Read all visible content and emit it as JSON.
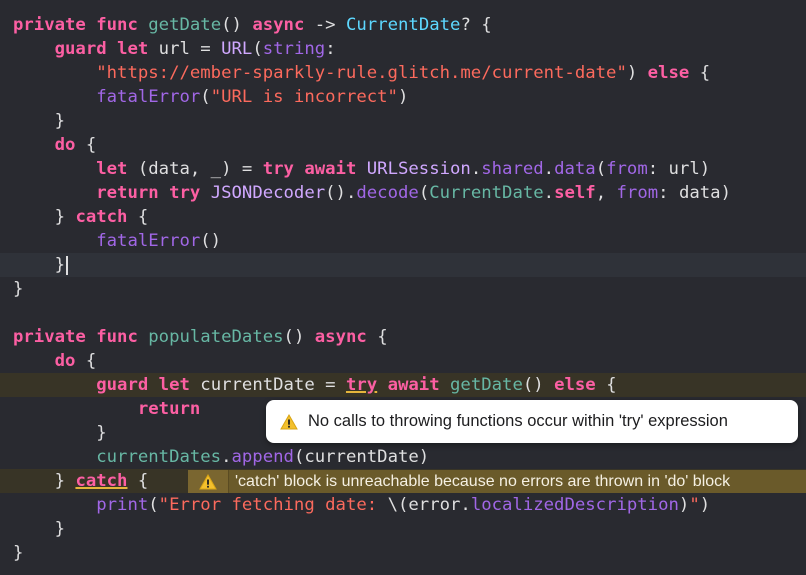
{
  "editor": {
    "lines": [
      {
        "segments": [
          {
            "t": "private",
            "c": "kw"
          },
          {
            "t": " ",
            "c": "plain"
          },
          {
            "t": "func",
            "c": "kw"
          },
          {
            "t": " ",
            "c": "plain"
          },
          {
            "t": "getDate",
            "c": "fn-decl"
          },
          {
            "t": "() ",
            "c": "plain"
          },
          {
            "t": "async",
            "c": "kw"
          },
          {
            "t": " -> ",
            "c": "plain"
          },
          {
            "t": "CurrentDate",
            "c": "type-decl"
          },
          {
            "t": "? {",
            "c": "plain"
          }
        ]
      },
      {
        "segments": [
          {
            "t": "    ",
            "c": "plain"
          },
          {
            "t": "guard",
            "c": "kw"
          },
          {
            "t": " ",
            "c": "plain"
          },
          {
            "t": "let",
            "c": "kw"
          },
          {
            "t": " url = ",
            "c": "plain"
          },
          {
            "t": "URL",
            "c": "other-type"
          },
          {
            "t": "(",
            "c": "plain"
          },
          {
            "t": "string",
            "c": "fn"
          },
          {
            "t": ":",
            "c": "plain"
          }
        ]
      },
      {
        "segments": [
          {
            "t": "        ",
            "c": "plain"
          },
          {
            "t": "\"https://ember-sparkly-rule.glitch.me/current-date\"",
            "c": "str"
          },
          {
            "t": ") ",
            "c": "plain"
          },
          {
            "t": "else",
            "c": "kw"
          },
          {
            "t": " {",
            "c": "plain"
          }
        ]
      },
      {
        "segments": [
          {
            "t": "        ",
            "c": "plain"
          },
          {
            "t": "fatalError",
            "c": "fn"
          },
          {
            "t": "(",
            "c": "plain"
          },
          {
            "t": "\"URL is incorrect\"",
            "c": "str"
          },
          {
            "t": ")",
            "c": "plain"
          }
        ]
      },
      {
        "segments": [
          {
            "t": "    }",
            "c": "plain"
          }
        ]
      },
      {
        "segments": [
          {
            "t": "    ",
            "c": "plain"
          },
          {
            "t": "do",
            "c": "kw"
          },
          {
            "t": " {",
            "c": "plain"
          }
        ]
      },
      {
        "segments": [
          {
            "t": "        ",
            "c": "plain"
          },
          {
            "t": "let",
            "c": "kw"
          },
          {
            "t": " (data, _) = ",
            "c": "plain"
          },
          {
            "t": "try",
            "c": "kw"
          },
          {
            "t": " ",
            "c": "plain"
          },
          {
            "t": "await",
            "c": "kw"
          },
          {
            "t": " ",
            "c": "plain"
          },
          {
            "t": "URLSession",
            "c": "other-type"
          },
          {
            "t": ".",
            "c": "plain"
          },
          {
            "t": "shared",
            "c": "fn"
          },
          {
            "t": ".",
            "c": "plain"
          },
          {
            "t": "data",
            "c": "fn"
          },
          {
            "t": "(",
            "c": "plain"
          },
          {
            "t": "from",
            "c": "fn"
          },
          {
            "t": ": url)",
            "c": "plain"
          }
        ]
      },
      {
        "segments": [
          {
            "t": "        ",
            "c": "plain"
          },
          {
            "t": "return",
            "c": "kw"
          },
          {
            "t": " ",
            "c": "plain"
          },
          {
            "t": "try",
            "c": "kw"
          },
          {
            "t": " ",
            "c": "plain"
          },
          {
            "t": "JSONDecoder",
            "c": "other-type"
          },
          {
            "t": "().",
            "c": "plain"
          },
          {
            "t": "decode",
            "c": "fn"
          },
          {
            "t": "(",
            "c": "plain"
          },
          {
            "t": "CurrentDate",
            "c": "proj-fn"
          },
          {
            "t": ".",
            "c": "plain"
          },
          {
            "t": "self",
            "c": "kw"
          },
          {
            "t": ", ",
            "c": "plain"
          },
          {
            "t": "from",
            "c": "fn"
          },
          {
            "t": ": data)",
            "c": "plain"
          }
        ]
      },
      {
        "segments": [
          {
            "t": "    } ",
            "c": "plain"
          },
          {
            "t": "catch",
            "c": "kw"
          },
          {
            "t": " {",
            "c": "plain"
          }
        ]
      },
      {
        "segments": [
          {
            "t": "        ",
            "c": "plain"
          },
          {
            "t": "fatalError",
            "c": "fn"
          },
          {
            "t": "()",
            "c": "plain"
          }
        ]
      },
      {
        "segments": [
          {
            "t": "    }",
            "c": "plain"
          }
        ],
        "caret": true,
        "highlight": "current"
      },
      {
        "segments": [
          {
            "t": "}",
            "c": "plain"
          }
        ]
      },
      {
        "segments": []
      },
      {
        "segments": [
          {
            "t": "private",
            "c": "kw"
          },
          {
            "t": " ",
            "c": "plain"
          },
          {
            "t": "func",
            "c": "kw"
          },
          {
            "t": " ",
            "c": "plain"
          },
          {
            "t": "populateDates",
            "c": "fn-decl"
          },
          {
            "t": "() ",
            "c": "plain"
          },
          {
            "t": "async",
            "c": "kw"
          },
          {
            "t": " {",
            "c": "plain"
          }
        ]
      },
      {
        "segments": [
          {
            "t": "    ",
            "c": "plain"
          },
          {
            "t": "do",
            "c": "kw"
          },
          {
            "t": " {",
            "c": "plain"
          }
        ]
      },
      {
        "segments": [
          {
            "t": "        ",
            "c": "plain"
          },
          {
            "t": "guard",
            "c": "kw"
          },
          {
            "t": " ",
            "c": "plain"
          },
          {
            "t": "let",
            "c": "kw"
          },
          {
            "t": " currentDate = ",
            "c": "plain"
          },
          {
            "t": "try",
            "c": "kw",
            "warn": true
          },
          {
            "t": " ",
            "c": "plain"
          },
          {
            "t": "await",
            "c": "kw"
          },
          {
            "t": " ",
            "c": "plain"
          },
          {
            "t": "getDate",
            "c": "proj-fn"
          },
          {
            "t": "() ",
            "c": "plain"
          },
          {
            "t": "else",
            "c": "kw"
          },
          {
            "t": " {",
            "c": "plain"
          }
        ],
        "highlight": "warn"
      },
      {
        "segments": [
          {
            "t": "            ",
            "c": "plain"
          },
          {
            "t": "return",
            "c": "kw"
          }
        ]
      },
      {
        "segments": [
          {
            "t": "        }",
            "c": "plain"
          }
        ]
      },
      {
        "segments": [
          {
            "t": "        ",
            "c": "plain"
          },
          {
            "t": "currentDates",
            "c": "proj-fn"
          },
          {
            "t": ".",
            "c": "plain"
          },
          {
            "t": "append",
            "c": "fn"
          },
          {
            "t": "(currentDate)",
            "c": "plain"
          }
        ]
      },
      {
        "segments": [
          {
            "t": "    } ",
            "c": "plain"
          },
          {
            "t": "catch",
            "c": "kw",
            "warn": true
          },
          {
            "t": " {",
            "c": "plain"
          }
        ],
        "highlight": "warn"
      },
      {
        "segments": [
          {
            "t": "        ",
            "c": "plain"
          },
          {
            "t": "print",
            "c": "fn"
          },
          {
            "t": "(",
            "c": "plain"
          },
          {
            "t": "\"Error fetching date: ",
            "c": "str"
          },
          {
            "t": "\\(error.",
            "c": "plain"
          },
          {
            "t": "localizedDescription",
            "c": "fn"
          },
          {
            "t": ")",
            "c": "plain"
          },
          {
            "t": "\"",
            "c": "str"
          },
          {
            "t": ")",
            "c": "plain"
          }
        ]
      },
      {
        "segments": [
          {
            "t": "    }",
            "c": "plain"
          }
        ]
      },
      {
        "segments": [
          {
            "t": "}",
            "c": "plain"
          }
        ]
      }
    ]
  },
  "issues": {
    "popover_text": "No calls to throwing functions occur within 'try' expression",
    "inline_text": "'catch' block is unreachable because no errors are thrown in 'do' block",
    "warning_icon": "warning-triangle-icon"
  },
  "colors": {
    "background": "#292a30",
    "keyword": "#fc5fa3",
    "string": "#fc6a5d",
    "warning": "#e5b53c"
  }
}
